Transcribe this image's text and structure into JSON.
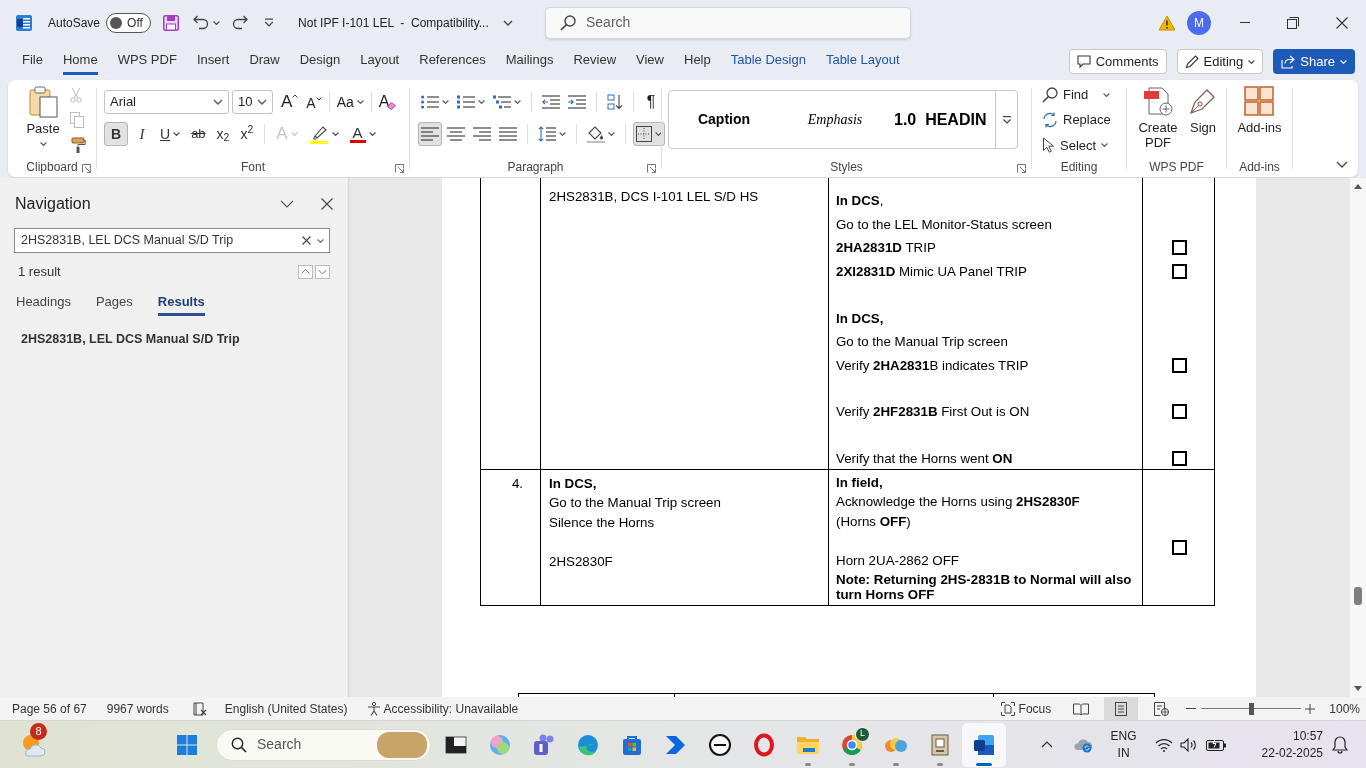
{
  "title_bar": {
    "autosave_label": "AutoSave",
    "autosave": {
      "on": false,
      "label": "Off"
    },
    "document_title": "Not IPF I-101 LEL  -  Compatibility...",
    "search_placeholder": "Search",
    "avatar": "M"
  },
  "ribbon_tabs": [
    {
      "label": "File",
      "selected": false,
      "kind": "standard"
    },
    {
      "label": "Home",
      "selected": true,
      "kind": "standard"
    },
    {
      "label": "WPS PDF",
      "selected": false,
      "kind": "standard"
    },
    {
      "label": "Insert",
      "selected": false,
      "kind": "standard"
    },
    {
      "label": "Draw",
      "selected": false,
      "kind": "standard"
    },
    {
      "label": "Design",
      "selected": false,
      "kind": "standard"
    },
    {
      "label": "Layout",
      "selected": false,
      "kind": "standard"
    },
    {
      "label": "References",
      "selected": false,
      "kind": "standard"
    },
    {
      "label": "Mailings",
      "selected": false,
      "kind": "standard"
    },
    {
      "label": "Review",
      "selected": false,
      "kind": "standard"
    },
    {
      "label": "View",
      "selected": false,
      "kind": "standard"
    },
    {
      "label": "Help",
      "selected": false,
      "kind": "standard"
    },
    {
      "label": "Table Design",
      "selected": false,
      "kind": "contextual"
    },
    {
      "label": "Table Layout",
      "selected": false,
      "kind": "contextual"
    }
  ],
  "ribbon_actions": [
    {
      "label": "Comments",
      "kind": "comments"
    },
    {
      "label": "Editing",
      "kind": "mode"
    },
    {
      "label": "Share",
      "kind": "share"
    }
  ],
  "ribbon": {
    "clipboard": {
      "paste": "Paste",
      "tools": [
        {
          "kind": "cut",
          "disabled": true
        },
        {
          "kind": "copy",
          "disabled": true
        },
        {
          "kind": "format_painter",
          "disabled": false
        }
      ],
      "group_label": "Clipboard"
    },
    "font": {
      "name": "Arial",
      "size": "10",
      "size_buttons": [
        {
          "kind": "grow",
          "glyph": "A"
        },
        {
          "kind": "shrink",
          "glyph": "A"
        }
      ],
      "change_case": "Aa",
      "clear_formatting": "A",
      "format_buttons": [
        {
          "kind": "bold",
          "glyph": "B",
          "selected": true,
          "disabled": false
        },
        {
          "kind": "italic",
          "glyph": "I",
          "selected": false,
          "disabled": false
        },
        {
          "kind": "underline",
          "glyph": "U",
          "selected": false,
          "disabled": false
        },
        {
          "kind": "strikethrough",
          "glyph": "ab",
          "selected": false,
          "disabled": false
        },
        {
          "kind": "subscript",
          "glyph": "x$_{2}$",
          "selected": false,
          "disabled": false
        },
        {
          "kind": "superscript",
          "glyph": "x$^{2}$",
          "selected": false,
          "disabled": false
        },
        {
          "kind": "effects",
          "glyph": "A",
          "selected": false,
          "disabled": true
        },
        {
          "kind": "highlight",
          "selected": false,
          "disabled": false
        },
        {
          "kind": "font_color",
          "glyph": "A",
          "selected": false,
          "disabled": false
        }
      ],
      "group_label": "Font"
    },
    "paragraph": {
      "row_1": [
        {
          "kind": "bullets",
          "selected": false
        },
        {
          "kind": "numbering",
          "selected": false
        },
        {
          "kind": "multilevel",
          "selected": false
        },
        {
          "kind": "decrease_indent",
          "selected": false
        },
        {
          "kind": "increase_indent",
          "selected": false
        },
        {
          "kind": "sort",
          "selected": false
        },
        {
          "kind": "show_marks",
          "glyph": "¶",
          "selected": false
        }
      ],
      "row_2": [
        {
          "kind": "align_left",
          "selected": true
        },
        {
          "kind": "align_center",
          "selected": false
        },
        {
          "kind": "align_right",
          "selected": false
        },
        {
          "kind": "justify",
          "selected": false
        },
        {
          "kind": "line_spacing",
          "selected": false
        },
        {
          "kind": "shading",
          "selected": false
        },
        {
          "kind": "borders",
          "selected": true
        }
      ],
      "group_label": "Paragraph"
    },
    "styles": {
      "items": [
        {
          "label": "Caption",
          "kind": "caption"
        },
        {
          "label": "Emphasis",
          "kind": "emphasis"
        },
        {
          "label": "1.0  HEADIN",
          "kind": "heading"
        }
      ],
      "group_label": "Styles"
    },
    "editing": {
      "items": [
        {
          "label": "Find",
          "kind": "find"
        },
        {
          "label": "Replace",
          "kind": "replace"
        },
        {
          "label": "Select",
          "kind": "select"
        }
      ],
      "group_label": "Editing"
    },
    "wps_pdf": {
      "items": [
        {
          "label": "Create PDF",
          "kind": "create_pdf"
        },
        {
          "label": "Sign",
          "kind": "sign"
        }
      ],
      "group_label": "WPS PDF"
    },
    "add_ins": {
      "items": [
        {
          "label": "Add-ins",
          "kind": "add_ins"
        }
      ],
      "group_label": "Add-ins"
    }
  },
  "navigation": {
    "title": "Navigation",
    "search_value": "2HS2831B, LEL DCS Manual S/D Trip",
    "result_count": "1 result",
    "tabs": [
      {
        "label": "Headings",
        "selected": false
      },
      {
        "label": "Pages",
        "selected": false
      },
      {
        "label": "Results",
        "selected": true
      }
    ],
    "results": [
      "2HS2831B, LEL DCS Manual S/D Trip"
    ]
  },
  "document": {
    "table": {
      "rows": [
        {
          "column_2": [
            {
              "kind": "text",
              "text": "2HS2831B, DCS I-101 LEL S/D HS",
              "bold": false
            }
          ],
          "column_3": [
            {
              "kind": "text",
              "text": "**In DCS**,",
              "bold": false
            },
            {
              "kind": "text",
              "text": "Go to the LEL Monitor-Status screen",
              "bold": false
            },
            {
              "kind": "check",
              "text": "**2HA2831D** TRIP",
              "bold": false,
              "checked": false
            },
            {
              "kind": "check",
              "text": "**2XI2831D** Mimic UA Panel TRIP",
              "bold": false,
              "checked": false
            },
            {
              "kind": "blank"
            },
            {
              "kind": "text",
              "text": "In DCS,",
              "bold": true
            },
            {
              "kind": "text",
              "text": "Go to the Manual Trip screen",
              "bold": false
            },
            {
              "kind": "check",
              "text": "Verify **2HA2831**B indicates TRIP",
              "bold": false,
              "checked": false
            },
            {
              "kind": "blank"
            },
            {
              "kind": "check",
              "text": "Verify **2HF2831B** First Out is ON",
              "bold": false,
              "checked": false
            },
            {
              "kind": "blank"
            },
            {
              "kind": "check",
              "text": "Verify that the Horns went **ON**",
              "bold": false,
              "checked": false
            }
          ]
        },
        {
          "number": "4.",
          "column_2": [
            {
              "kind": "text",
              "text": "In DCS,",
              "bold": true
            },
            {
              "kind": "text",
              "text": "Go to the Manual Trip screen",
              "bold": false
            },
            {
              "kind": "text",
              "text": "Silence the Horns",
              "bold": false
            },
            {
              "kind": "blank"
            },
            {
              "kind": "text",
              "text": "2HS2830F",
              "bold": false
            }
          ],
          "column_3": [
            {
              "kind": "text",
              "text": "In field,",
              "bold": true
            },
            {
              "kind": "text",
              "text": "Acknowledge the Horns using **2HS2830F**",
              "bold": false
            },
            {
              "kind": "text",
              "text": "(Horns **OFF**)",
              "bold": false
            },
            {
              "kind": "blank"
            },
            {
              "kind": "text",
              "text": "Horn 2UA-2862 OFF",
              "bold": false
            },
            {
              "kind": "text",
              "text": "Note: Returning 2HS-2831B to Normal will also turn Horns OFF",
              "bold": true
            }
          ],
          "column_4": {
            "checked": false
          }
        }
      ]
    }
  },
  "status_bar": {
    "page": "Page 56 of 67",
    "words": "9967 words",
    "language": "English (United States)",
    "accessibility": "Accessibility: Unavailable",
    "focus": "Focus",
    "views": [
      {
        "kind": "read",
        "selected": false
      },
      {
        "kind": "print",
        "selected": true
      },
      {
        "kind": "web",
        "selected": false
      }
    ],
    "zoom": {
      "level": 0.5,
      "label": "100%"
    }
  },
  "taskbar": {
    "weather_badge": "8",
    "search_placeholder": "Search",
    "apps": [
      {
        "kind": "task_view",
        "running": false,
        "active": false
      },
      {
        "kind": "copilot",
        "running": false,
        "active": false
      },
      {
        "kind": "teams",
        "running": false,
        "active": false
      },
      {
        "kind": "edge",
        "running": false,
        "active": false
      },
      {
        "kind": "store",
        "running": false,
        "active": false
      },
      {
        "kind": "automate",
        "running": false,
        "active": false
      },
      {
        "kind": "dell",
        "running": false,
        "active": false
      },
      {
        "kind": "opera",
        "running": false,
        "active": false
      },
      {
        "kind": "files",
        "running": true,
        "active": false
      },
      {
        "kind": "chrome",
        "running": true,
        "active": false,
        "badge": "L"
      },
      {
        "kind": "blobs",
        "running": true,
        "active": false
      },
      {
        "kind": "archive",
        "running": true,
        "active": false
      },
      {
        "kind": "word",
        "running": true,
        "active": true
      }
    ],
    "tray": {
      "language": [
        "ENG",
        "IN"
      ],
      "time": "10:57",
      "date": "22-02-2025"
    }
  }
}
